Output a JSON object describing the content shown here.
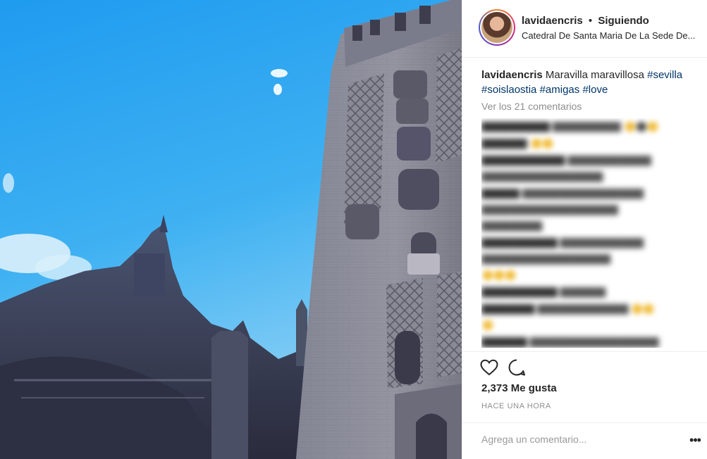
{
  "header": {
    "username": "lavidaencris",
    "separator": "•",
    "follow_status": "Siguiendo",
    "location": "Catedral De Santa Maria De La Sede De..."
  },
  "caption": {
    "username": "lavidaencris",
    "text": "Maravilla maravillosa",
    "hashtags": [
      "#sevilla",
      "#soislaostia",
      "#amigas",
      "#love"
    ]
  },
  "view_comments": "Ver los 21 comentarios",
  "comments_blurred": true,
  "actions": {
    "like_icon": "heart-icon",
    "comment_icon": "speech-bubble-icon",
    "likes": "2,373 Me gusta",
    "time_ago": "HACE UNA HORA"
  },
  "add_comment": {
    "placeholder": "Agrega un comentario...",
    "more_icon": "ellipsis-icon",
    "more_label": "•••"
  },
  "colors": {
    "sky": "#2ea3ee",
    "hashtag": "#003569",
    "muted": "#8e8e8e",
    "divider": "#efefef"
  }
}
